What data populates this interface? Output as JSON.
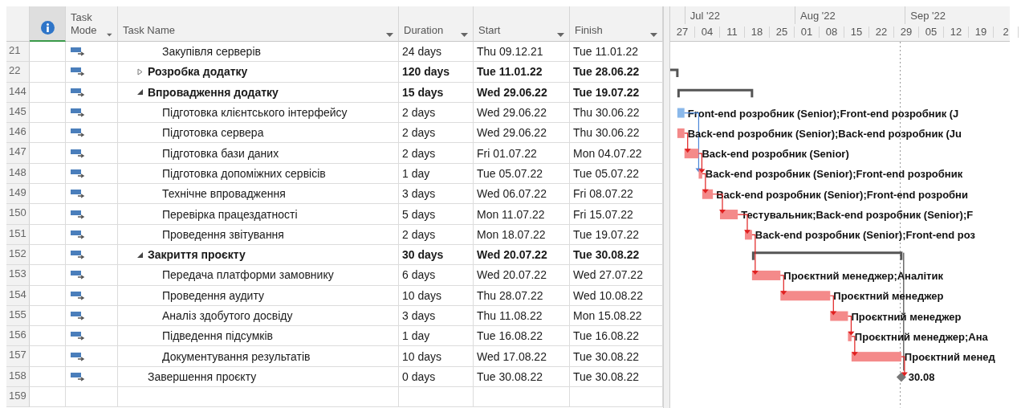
{
  "table": {
    "columns": {
      "task_mode": "Task Mode",
      "task_name": "Task Name",
      "duration": "Duration",
      "start": "Start",
      "finish": "Finish"
    },
    "tasks": [
      {
        "kind": "offscreen-parent",
        "children": [
          {
            "id": "21",
            "kind": "task",
            "name": "Закупівля серверів",
            "duration": "24 days",
            "start": "Thu 09.12.21",
            "finish": "Tue 11.01.22"
          }
        ]
      },
      {
        "id": "22",
        "kind": "summary",
        "expanded": false,
        "name": "Розробка додатку",
        "duration": "120 days",
        "start": "Tue 11.01.22",
        "finish": "Tue 28.06.22"
      },
      {
        "id": "144",
        "kind": "summary",
        "expanded": true,
        "name": "Впровадження додатку",
        "duration": "15 days",
        "start": "Wed 29.06.22",
        "finish": "Tue 19.07.22",
        "children": [
          {
            "id": "145",
            "kind": "task",
            "critical": false,
            "name": "Підготовка клієнтського інтерфейсу",
            "duration": "2 days",
            "start": "Wed 29.06.22",
            "finish": "Thu 30.06.22",
            "bar_label": "Front-end розробник (Senior);Front-end розробник (J"
          },
          {
            "id": "146",
            "kind": "task",
            "critical": true,
            "name": "Підготовка сервера",
            "duration": "2 days",
            "start": "Wed 29.06.22",
            "finish": "Thu 30.06.22",
            "bar_label": "Back-end розробник (Senior);Back-end розробник (Ju"
          },
          {
            "id": "147",
            "kind": "task",
            "critical": true,
            "linked": true,
            "name": "Підготовка бази даних",
            "duration": "2 days",
            "start": "Fri 01.07.22",
            "finish": "Mon 04.07.22",
            "bar_label": "Back-end розробник (Senior)"
          },
          {
            "id": "148",
            "kind": "task",
            "critical": true,
            "linked": true,
            "name": "Підготовка допоміжних сервісів",
            "duration": "1 day",
            "start": "Tue 05.07.22",
            "finish": "Tue 05.07.22",
            "bar_label": "Back-end розробник (Senior);Front-end розробник"
          },
          {
            "id": "149",
            "kind": "task",
            "critical": true,
            "linked": true,
            "name": "Технічне впровадження",
            "duration": "3 days",
            "start": "Wed 06.07.22",
            "finish": "Fri 08.07.22",
            "bar_label": "Back-end розробник (Senior);Front-end розробни"
          },
          {
            "id": "150",
            "kind": "task",
            "critical": true,
            "linked": true,
            "name": "Перевірка працездатності",
            "duration": "5 days",
            "start": "Mon 11.07.22",
            "finish": "Fri 15.07.22",
            "bar_label": "Тестувальник;Back-end розробник (Senior);F"
          },
          {
            "id": "151",
            "kind": "task",
            "critical": true,
            "linked": true,
            "name": "Проведення звітування",
            "duration": "2 days",
            "start": "Mon 18.07.22",
            "finish": "Tue 19.07.22",
            "bar_label": "Back-end розробник (Senior);Front-end роз"
          }
        ]
      },
      {
        "id": "152",
        "kind": "summary",
        "expanded": true,
        "name": "Закриття проєкту",
        "duration": "30 days",
        "start": "Wed 20.07.22",
        "finish": "Tue 30.08.22",
        "children": [
          {
            "id": "153",
            "kind": "task",
            "critical": true,
            "linked": true,
            "name": "Передача платформи замовнику",
            "duration": "6 days",
            "start": "Wed 20.07.22",
            "finish": "Wed 27.07.22",
            "bar_label": "Проєктний менеджер;Аналітик"
          },
          {
            "id": "154",
            "kind": "task",
            "critical": true,
            "linked": true,
            "name": "Проведення аудиту",
            "duration": "10 days",
            "start": "Thu 28.07.22",
            "finish": "Wed 10.08.22",
            "bar_label": "Проєктний менеджер"
          },
          {
            "id": "155",
            "kind": "task",
            "critical": true,
            "linked": true,
            "name": "Аналіз здобутого досвіду",
            "duration": "3 days",
            "start": "Thu 11.08.22",
            "finish": "Mon 15.08.22",
            "bar_label": "Проєктний менеджер"
          },
          {
            "id": "156",
            "kind": "task",
            "critical": true,
            "linked": true,
            "name": "Підведення підсумків",
            "duration": "1 day",
            "start": "Tue 16.08.22",
            "finish": "Tue 16.08.22",
            "bar_label": "Проєктний менеджер;Ана"
          },
          {
            "id": "157",
            "kind": "task",
            "critical": true,
            "linked": true,
            "name": "Документування результатів",
            "duration": "10 days",
            "start": "Wed 17.08.22",
            "finish": "Tue 30.08.22",
            "bar_label": "Проєктний менед"
          }
        ]
      },
      {
        "id": "158",
        "kind": "milestone",
        "linked": true,
        "name": "Завершення проєкту",
        "duration": "0 days",
        "start": "Tue 30.08.22",
        "finish": "Tue 30.08.22",
        "bar_label": "30.08"
      },
      {
        "id": "159",
        "kind": "blank"
      }
    ]
  },
  "timescale": {
    "months": [
      "Jul '22",
      "Aug '22",
      "Sep '22"
    ],
    "weeks": [
      "27",
      "04",
      "11",
      "18",
      "25",
      "01",
      "08",
      "15",
      "22",
      "29",
      "05",
      "12",
      "19",
      "2"
    ]
  }
}
